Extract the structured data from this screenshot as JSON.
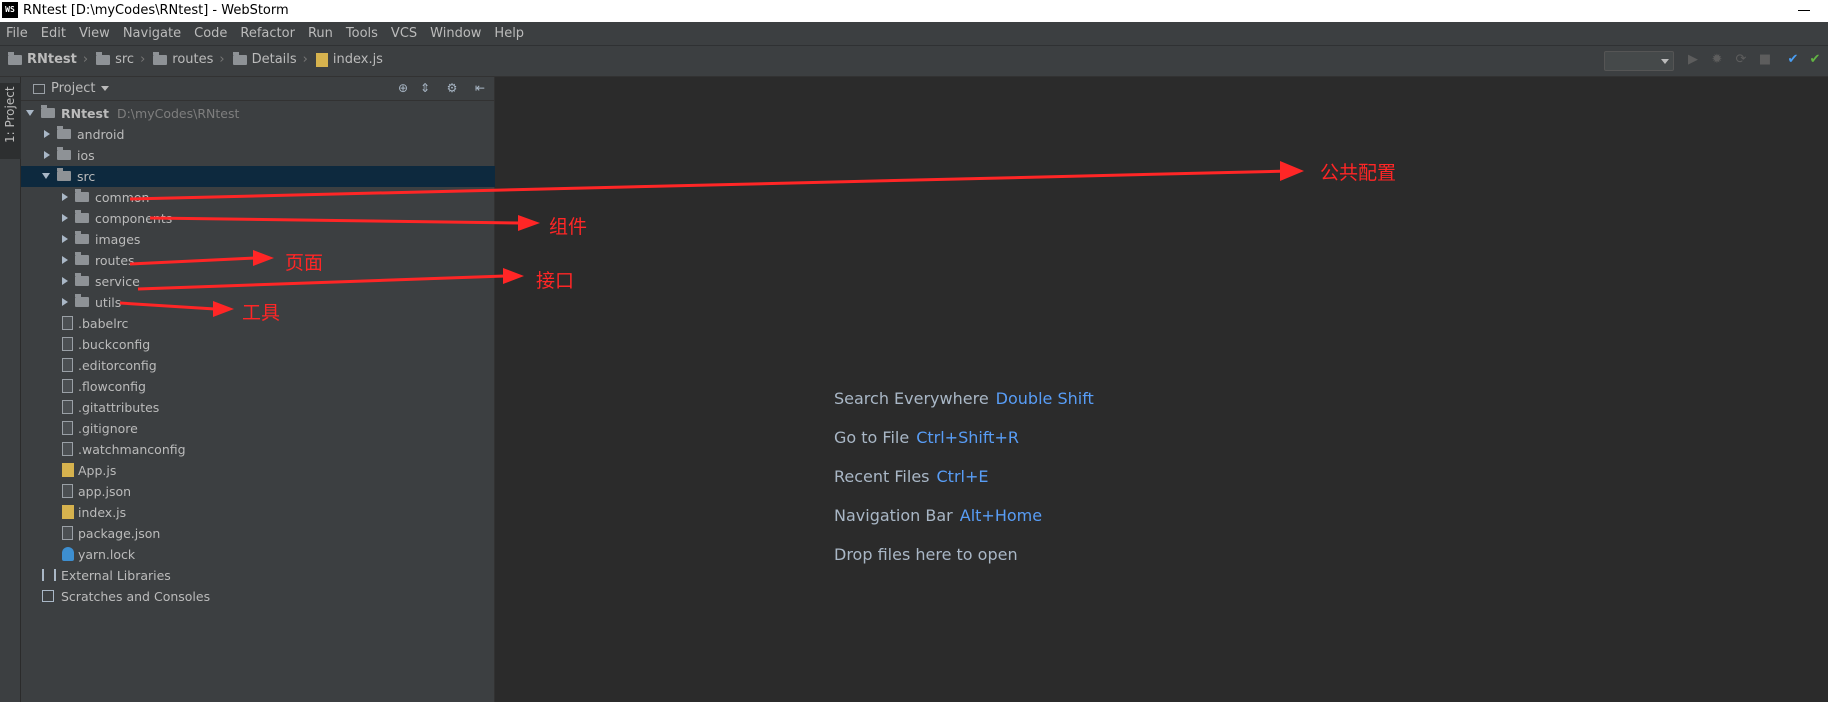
{
  "window": {
    "title": "RNtest [D:\\myCodes\\RNtest] - WebStorm",
    "logo": "WS"
  },
  "menu": [
    "File",
    "Edit",
    "View",
    "Navigate",
    "Code",
    "Refactor",
    "Run",
    "Tools",
    "VCS",
    "Window",
    "Help"
  ],
  "breadcrumbs": [
    "RNtest",
    "src",
    "routes",
    "Details",
    "index.js"
  ],
  "toolbar_icons": [
    "run-icon",
    "debug-icon",
    "coverage-icon",
    "stop-icon",
    "vcs-update-icon",
    "vcs-commit-icon"
  ],
  "project_panel": {
    "side_tab": "1: Project",
    "header": "Project",
    "header_icons": [
      "locate-icon",
      "collapse-icon",
      "gear-icon",
      "hide-icon"
    ],
    "root": {
      "name": "RNtest",
      "path": "D:\\myCodes\\RNtest"
    },
    "items": [
      {
        "name": "android"
      },
      {
        "name": "ios"
      },
      {
        "name": "src"
      },
      {
        "name": "common"
      },
      {
        "name": "components"
      },
      {
        "name": "images"
      },
      {
        "name": "routes"
      },
      {
        "name": "service"
      },
      {
        "name": "utils"
      },
      {
        "name": ".babelrc"
      },
      {
        "name": ".buckconfig"
      },
      {
        "name": ".editorconfig"
      },
      {
        "name": ".flowconfig"
      },
      {
        "name": ".gitattributes"
      },
      {
        "name": ".gitignore"
      },
      {
        "name": ".watchmanconfig"
      },
      {
        "name": "App.js"
      },
      {
        "name": "app.json"
      },
      {
        "name": "index.js"
      },
      {
        "name": "package.json"
      },
      {
        "name": "yarn.lock"
      },
      {
        "name": "External Libraries"
      },
      {
        "name": "Scratches and Consoles"
      }
    ]
  },
  "editor_hints": [
    {
      "label": "Search Everywhere",
      "key": "Double Shift"
    },
    {
      "label": "Go to File",
      "key": "Ctrl+Shift+R"
    },
    {
      "label": "Recent Files",
      "key": "Ctrl+E"
    },
    {
      "label": "Navigation Bar",
      "key": "Alt+Home"
    },
    {
      "label": "Drop files here to open",
      "key": ""
    }
  ],
  "annotations": {
    "color": "#ff2626",
    "labels": [
      "公共配置",
      "组件",
      "页面",
      "接口",
      "工具"
    ]
  }
}
